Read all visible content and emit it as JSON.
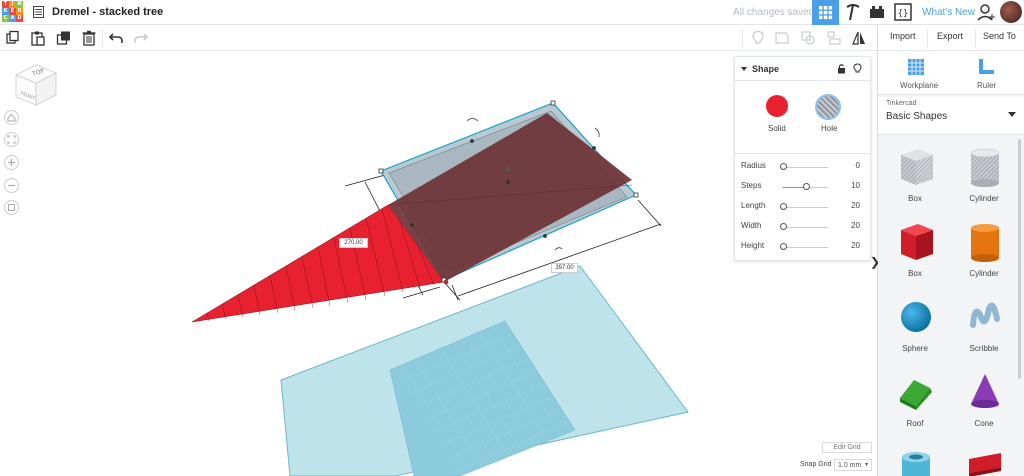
{
  "app": {
    "logo_letters": [
      "T",
      "I",
      "N",
      "K",
      "E",
      "R",
      "C",
      "A",
      "D"
    ],
    "logo_colors": [
      "#e94b3c",
      "#f6921e",
      "#8cc63f",
      "#4b9ee8",
      "#e94b3c",
      "#f6921e",
      "#8cc63f",
      "#4b9ee8",
      "#e94b3c"
    ],
    "design_title": "Dremel - stacked tree",
    "save_status": "All changes saved",
    "whats_new": "What's New",
    "accent": "#4b9ee8"
  },
  "toolbar": {
    "tools": [
      "copy-icon",
      "paste-icon",
      "duplicate-icon",
      "trash-icon",
      "undo-icon",
      "redo-icon"
    ],
    "right_tools": [
      "note-icon",
      "comment-icon",
      "group-icon",
      "align-icon",
      "mirror-icon"
    ]
  },
  "actions": {
    "import": "Import",
    "export": "Export",
    "send_to": "Send To"
  },
  "panel_tools": {
    "workplane": "Workplane",
    "ruler": "Ruler"
  },
  "library": {
    "source": "Tinkercad",
    "name": "Basic Shapes"
  },
  "shapes": [
    {
      "label": "Box"
    },
    {
      "label": "Cylinder"
    },
    {
      "label": "Box"
    },
    {
      "label": "Cylinder"
    },
    {
      "label": "Sphere"
    },
    {
      "label": "Scribble"
    },
    {
      "label": "Roof"
    },
    {
      "label": "Cone"
    }
  ],
  "inspector": {
    "title": "Shape",
    "solid": "Solid",
    "hole": "Hole",
    "props": [
      {
        "name": "Radius",
        "value": "0",
        "fraction": 0.0
      },
      {
        "name": "Steps",
        "value": "10",
        "fraction": 0.5
      },
      {
        "name": "Length",
        "value": "20",
        "fraction": 0.0
      },
      {
        "name": "Width",
        "value": "20",
        "fraction": 0.0
      },
      {
        "name": "Height",
        "value": "20",
        "fraction": 0.0
      }
    ]
  },
  "viewcube": {
    "top": "TOP",
    "front": "FRONT"
  },
  "dimensions": {
    "width": "270.00",
    "length": "397.00"
  },
  "grid": {
    "edit": "Edit Grid",
    "snap_label": "Snap Grid",
    "snap_value": "1.0 mm"
  }
}
